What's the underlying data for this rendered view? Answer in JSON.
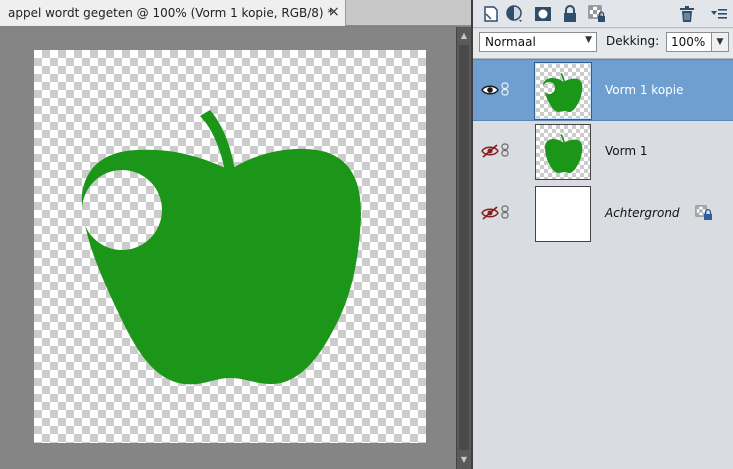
{
  "document": {
    "tab_title": "appel wordt gegeten @ 100% (Vorm 1 kopie, RGB/8) *",
    "close_glyph": "×"
  },
  "colors": {
    "shape_fill": "#1b9618",
    "selection_blue": "#6e9fd0",
    "panel_bg": "#d9dde2",
    "canvas_surround": "#858585"
  },
  "panel": {
    "toolbar_icons": [
      "new-layer-icon",
      "adjustment-layer-icon",
      "layer-mask-icon",
      "lock-all-icon",
      "lock-transparency-icon",
      "delete-layer-icon",
      "panel-menu-icon"
    ],
    "blend_mode": "Normaal",
    "opacity_label": "Dekking:",
    "opacity_value": "100%"
  },
  "layers": [
    {
      "name": "Vorm 1 kopie",
      "visible": true,
      "selected": true,
      "thumbnail": "bitten-apple",
      "locked": false,
      "italic": false
    },
    {
      "name": "Vorm 1",
      "visible": false,
      "selected": false,
      "thumbnail": "apple",
      "locked": false,
      "italic": false
    },
    {
      "name": "Achtergrond",
      "visible": false,
      "selected": false,
      "thumbnail": "white",
      "locked": true,
      "italic": true
    }
  ]
}
